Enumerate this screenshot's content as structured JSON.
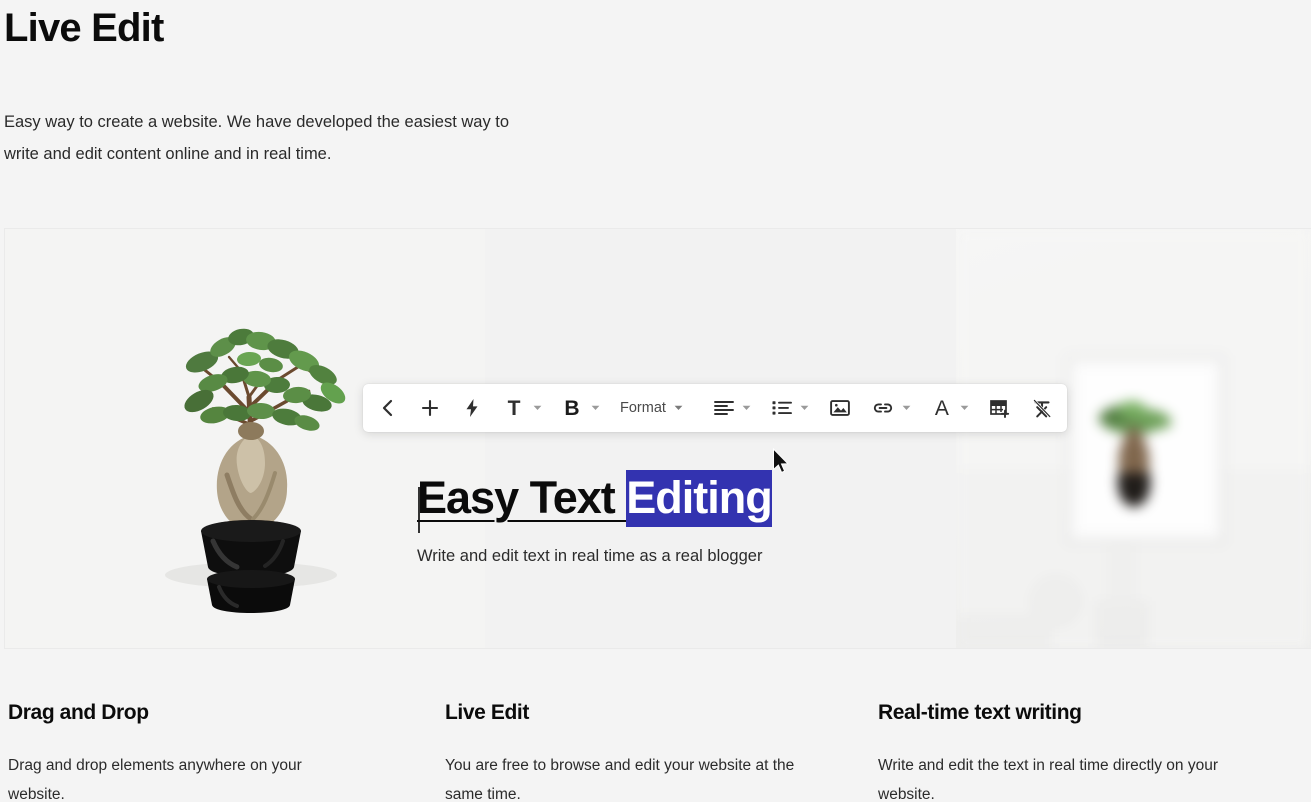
{
  "page": {
    "title": "Live Edit",
    "intro": "Easy way to create a website. We have developed the easiest way to write and edit content online and in real time."
  },
  "toolbar": {
    "name": "rich-text-editor-toolbar",
    "back_label": "‹",
    "add_label": "+",
    "lightning_label": "lightning",
    "text_style_label": "T",
    "bold_label": "B",
    "format_label": "Format",
    "align_label": "align-left",
    "list_label": "bulleted-list",
    "image_label": "image",
    "link_label": "link",
    "font_color_label": "A",
    "table_label": "insert-table",
    "clear_format_label": "remove-format",
    "caret_glyph": "▾"
  },
  "hero": {
    "headline_plain": "Easy Text ",
    "headline_selected": "Editing",
    "subtitle": "Write and edit text in real time as a real blogger",
    "selection_color": "#3333b0",
    "left_image_alt": "bonsai-plant-in-black-pot",
    "right_image_alt": "blurred-framed-plant-print-on-wall"
  },
  "features": [
    {
      "title": "Drag and Drop",
      "body": "Drag and drop elements anywhere on your website."
    },
    {
      "title": "Live Edit",
      "body": "You are free to browse and edit your website at the same time."
    },
    {
      "title": "Real-time text writing",
      "body": "Write and edit the text in real time directly on your website."
    }
  ],
  "colors": {
    "page_background": "#f4f4f4",
    "hero_background": "#f2f2f2",
    "text": "#111111",
    "accent": "#3333b0"
  }
}
